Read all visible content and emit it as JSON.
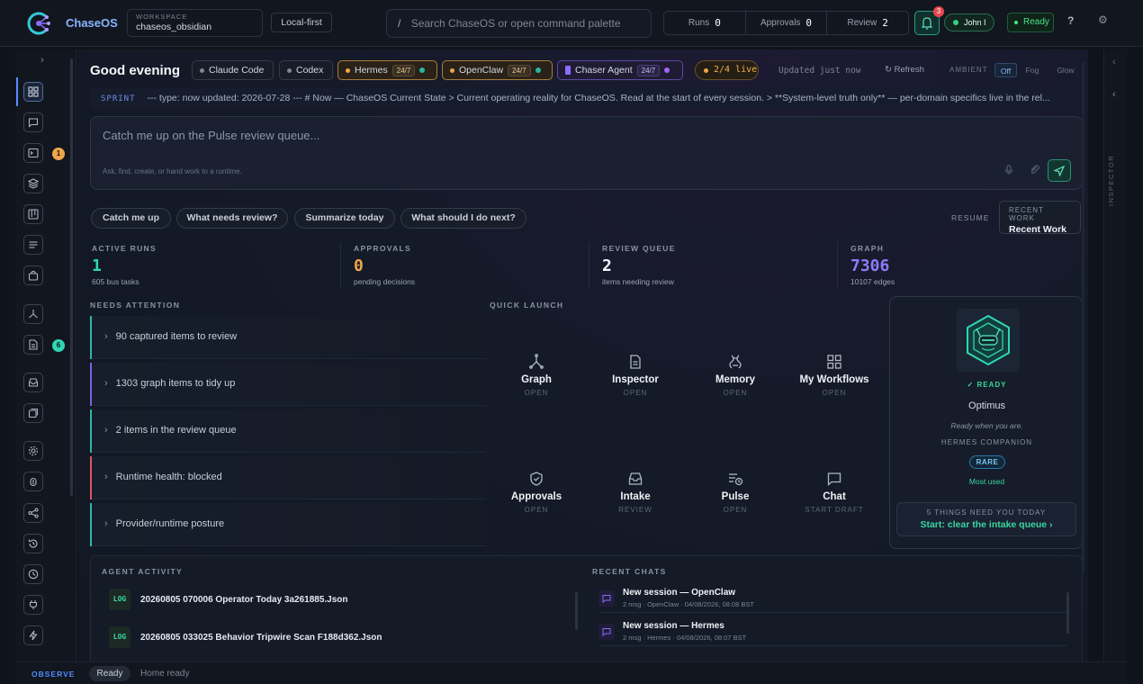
{
  "header": {
    "brand": "ChaseOS",
    "workspace_label": "WORKSPACE",
    "workspace_name": "chaseos_obsidian",
    "mode": "Local-first",
    "search_placeholder": "Search ChaseOS or open command palette",
    "search_prefix": "/",
    "stats": [
      {
        "label": "Runs",
        "value": "0"
      },
      {
        "label": "Approvals",
        "value": "0"
      },
      {
        "label": "Review",
        "value": "2"
      }
    ],
    "notifications": "3",
    "user": "John I",
    "status": "Ready"
  },
  "rail": {
    "badges": {
      "runs": "1",
      "docs": "6"
    }
  },
  "main": {
    "greeting": "Good evening",
    "runtimes": [
      {
        "name": "Claude Code",
        "style": "plain"
      },
      {
        "name": "Codex",
        "style": "plain"
      },
      {
        "name": "Hermes",
        "tag": "24/7",
        "style": "amber",
        "status_color": "#22b8a0"
      },
      {
        "name": "OpenClaw",
        "tag": "24/7",
        "style": "amber",
        "status_color": "#22b8a0"
      },
      {
        "name": "Chaser Agent",
        "tag": "24/7",
        "style": "purple",
        "status_color": "#a066ff"
      }
    ],
    "live": "2/4 live",
    "updated": "Updated just now",
    "refresh": "Refresh",
    "ambient_label": "AMBIENT",
    "ambient_options": [
      "Off",
      "Fog",
      "Glow"
    ],
    "sprint_tag": "SPRINT",
    "sprint_text": "--- type: now updated: 2026-07-28 --- # Now — ChaseOS Current State > Current operating reality for ChaseOS. Read at the start of every session. > **System-level truth only** — per-domain specifics live in the rel...",
    "compose_placeholder": "Catch me up on the Pulse review queue...",
    "compose_hint": "Ask, find, create, or hand work to a runtime.",
    "quick_prompts": [
      "Catch me up",
      "What needs review?",
      "Summarize today",
      "What should I do next?"
    ],
    "resume_label": "RESUME",
    "recent_work_label": "RECENT WORK",
    "recent_work_value": "Recent Work",
    "kpis": [
      {
        "label": "ACTIVE RUNS",
        "value": "1",
        "sub": "605 bus tasks",
        "color": "#2fd6b5"
      },
      {
        "label": "APPROVALS",
        "value": "0",
        "sub": "pending decisions",
        "color": "#f0a64a"
      },
      {
        "label": "REVIEW QUEUE",
        "value": "2",
        "sub": "items needing review",
        "color": "#f2f4f8"
      },
      {
        "label": "GRAPH",
        "value": "7306",
        "sub": "10107 edges",
        "color": "#8f7bff"
      }
    ],
    "needs_attention_label": "NEEDS ATTENTION",
    "needs_attention": [
      {
        "text": "90 captured items to review",
        "color": "#2fb7a8"
      },
      {
        "text": "1303 graph items to tidy up",
        "color": "#7a62e0"
      },
      {
        "text": "2 items in the review queue",
        "color": "#2fb7a8"
      },
      {
        "text": "Runtime health: blocked",
        "color": "#e05466"
      },
      {
        "text": "Provider/runtime posture",
        "color": "#2fb7a8"
      }
    ],
    "quick_launch_label": "QUICK LAUNCH",
    "quick_launch": [
      {
        "name": "Graph",
        "sub": "OPEN",
        "icon": "graph-icon"
      },
      {
        "name": "Inspector",
        "sub": "OPEN",
        "icon": "document-icon"
      },
      {
        "name": "Memory",
        "sub": "OPEN",
        "icon": "memory-icon"
      },
      {
        "name": "My Workflows",
        "sub": "OPEN",
        "icon": "grid-icon"
      },
      {
        "name": "Approvals",
        "sub": "OPEN",
        "icon": "shield-icon"
      },
      {
        "name": "Intake",
        "sub": "REVIEW",
        "icon": "inbox-icon"
      },
      {
        "name": "Pulse",
        "sub": "OPEN",
        "icon": "pulse-icon"
      },
      {
        "name": "Chat",
        "sub": "START DRAFT",
        "icon": "chat-icon"
      }
    ],
    "agent": {
      "ready": "✓ READY",
      "name": "Optimus",
      "tagline": "Ready when you are.",
      "role": "HERMES COMPANION",
      "rarity": "RARE",
      "usage": "Most used",
      "things_label": "5 THINGS NEED YOU TODAY",
      "things_cta": "Start: clear the intake queue ›"
    },
    "agent_activity_label": "AGENT ACTIVITY",
    "agent_activity": [
      {
        "tag": "LOG",
        "text": "20260805 070006 Operator Today 3a261885.Json"
      },
      {
        "tag": "LOG",
        "text": "20260805 033025 Behavior Tripwire Scan F188d362.Json"
      }
    ],
    "recent_chats_label": "RECENT CHATS",
    "recent_chats": [
      {
        "title": "New session — OpenClaw",
        "meta": "2 msg · OpenClaw · 04/08/2026, 08:08 BST"
      },
      {
        "title": "New session — Hermes",
        "meta": "2 msg · Hermes · 04/08/2026, 08:07 BST"
      }
    ]
  },
  "inspector": {
    "label": "INSPECTOR"
  },
  "statusbar": {
    "mode": "OBSERVE",
    "state": "Ready",
    "message": "Home ready"
  }
}
